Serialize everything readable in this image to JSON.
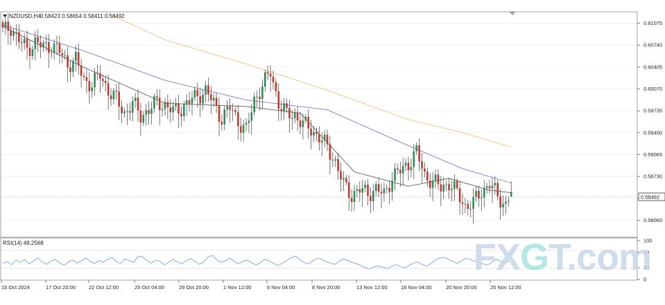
{
  "header": {
    "symbol": "NZDUSD,H4",
    "ohlc": "0.58423 0.58654 0.58411 0.58492"
  },
  "price_axis": {
    "ticks": [
      "0.61075",
      "0.60740",
      "0.60405",
      "0.60070",
      "0.59735",
      "0.59400",
      "0.59065",
      "0.58730",
      "0.58395",
      "0.58060"
    ],
    "current_price": "0.58492"
  },
  "rsi_panel": {
    "label": "RSI(14) 48.2568",
    "ticks": [
      "100",
      "70",
      "30",
      "0"
    ]
  },
  "time_axis": {
    "labels": [
      "15 Oct 2024",
      "17 Oct 20:00",
      "22 Oct 12:00",
      "25 Oct 04:00",
      "29 Oct 20:00",
      "1 Nov 12:00",
      "6 Nov 04:00",
      "8 Nov 20:00",
      "13 Nov 12:00",
      "18 Nov 04:00",
      "20 Nov 20:00",
      "25 Nov 12:00"
    ]
  },
  "watermark": {
    "text": "FXGT.com"
  },
  "colors": {
    "bull": "#2e8b57",
    "bear": "#c0392b",
    "ma_fast": "#606060",
    "ma_mid": "#7b7bd0",
    "ma_slow": "#f2c27a",
    "rsi": "#6fa8d6",
    "grid": "#e8e8e8",
    "watermark_main": "#c7d7e8",
    "watermark_accent": "#a7e3dc"
  },
  "chart_data": [
    {
      "type": "candlestick",
      "instrument": "NZDUSD",
      "timeframe": "H4",
      "x_labels": [
        "15 Oct 2024",
        "17 Oct 20:00",
        "22 Oct 12:00",
        "25 Oct 04:00",
        "29 Oct 20:00",
        "1 Nov 12:00",
        "6 Nov 04:00",
        "8 Nov 20:00",
        "13 Nov 12:00",
        "18 Nov 04:00",
        "20 Nov 20:00",
        "25 Nov 12:00"
      ],
      "y_ticks": [
        0.61075,
        0.6074,
        0.60405,
        0.6007,
        0.59735,
        0.594,
        0.59065,
        0.5873,
        0.58395,
        0.5806
      ],
      "ylim": [
        0.5781,
        0.6124
      ],
      "last_price": 0.58492,
      "last_bar": {
        "open": 0.58423,
        "high": 0.58654,
        "low": 0.58411,
        "close": 0.58492
      },
      "close_path": [
        [
          0,
          0.6095
        ],
        [
          3,
          0.6102
        ],
        [
          6,
          0.6081
        ],
        [
          9,
          0.6068
        ],
        [
          12,
          0.6078
        ],
        [
          15,
          0.6071
        ],
        [
          18,
          0.6074
        ],
        [
          21,
          0.6064
        ],
        [
          24,
          0.6045
        ],
        [
          27,
          0.6051
        ],
        [
          30,
          0.6021
        ],
        [
          33,
          0.6014
        ],
        [
          36,
          0.6028
        ],
        [
          39,
          0.6005
        ],
        [
          42,
          0.599
        ],
        [
          45,
          0.597
        ],
        [
          48,
          0.5985
        ],
        [
          51,
          0.5966
        ],
        [
          54,
          0.5975
        ],
        [
          57,
          0.5986
        ],
        [
          60,
          0.5983
        ],
        [
          63,
          0.5972
        ],
        [
          66,
          0.5978
        ],
        [
          69,
          0.5988
        ],
        [
          72,
          0.5997
        ],
        [
          75,
          0.6004
        ],
        [
          78,
          0.5985
        ],
        [
          81,
          0.5962
        ],
        [
          84,
          0.5978
        ],
        [
          87,
          0.5958
        ],
        [
          90,
          0.5943
        ],
        [
          93,
          0.599
        ],
        [
          96,
          0.6012
        ],
        [
          99,
          0.6032
        ],
        [
          102,
          0.5986
        ],
        [
          105,
          0.5967
        ],
        [
          108,
          0.5968
        ],
        [
          111,
          0.5952
        ],
        [
          114,
          0.5946
        ],
        [
          117,
          0.5932
        ],
        [
          120,
          0.5918
        ],
        [
          123,
          0.5895
        ],
        [
          126,
          0.586
        ],
        [
          129,
          0.5845
        ],
        [
          132,
          0.5852
        ],
        [
          135,
          0.5848
        ],
        [
          138,
          0.5853
        ],
        [
          141,
          0.5845
        ],
        [
          144,
          0.5873
        ],
        [
          147,
          0.5881
        ],
        [
          150,
          0.5893
        ],
        [
          153,
          0.591
        ],
        [
          156,
          0.5875
        ],
        [
          159,
          0.5865
        ],
        [
          162,
          0.5856
        ],
        [
          165,
          0.5863
        ],
        [
          168,
          0.5847
        ],
        [
          171,
          0.5828
        ],
        [
          174,
          0.5832
        ],
        [
          177,
          0.585
        ],
        [
          180,
          0.5862
        ],
        [
          183,
          0.5842
        ],
        [
          186,
          0.583
        ],
        [
          188,
          0.5849
        ]
      ],
      "moving_averages": [
        {
          "role": "fast",
          "path": [
            [
              0,
              0.6103
            ],
            [
              30,
              0.604
            ],
            [
              60,
              0.5985
            ],
            [
              90,
              0.598
            ],
            [
              110,
              0.597
            ],
            [
              130,
              0.588
            ],
            [
              150,
              0.5858
            ],
            [
              165,
              0.587
            ],
            [
              180,
              0.5852
            ],
            [
              188,
              0.5848
            ]
          ]
        },
        {
          "role": "mid",
          "path": [
            [
              0,
              0.6105
            ],
            [
              30,
              0.6065
            ],
            [
              60,
              0.602
            ],
            [
              90,
              0.599
            ],
            [
              120,
              0.5975
            ],
            [
              150,
              0.592
            ],
            [
              170,
              0.5885
            ],
            [
              188,
              0.5863
            ]
          ]
        },
        {
          "role": "slow",
          "path": [
            [
              38,
              0.6124
            ],
            [
              60,
              0.6082
            ],
            [
              90,
              0.6045
            ],
            [
              120,
              0.6005
            ],
            [
              150,
              0.596
            ],
            [
              170,
              0.594
            ],
            [
              188,
              0.5918
            ]
          ]
        }
      ]
    },
    {
      "type": "line",
      "series": [
        {
          "name": "RSI(14)",
          "last_value": 48.2568
        }
      ],
      "ylim": [
        0,
        100
      ],
      "y_ticks": [
        100,
        70,
        30,
        0
      ],
      "values": [
        42,
        46,
        38,
        50,
        44,
        52,
        40,
        47,
        55,
        45,
        39,
        48,
        51,
        43,
        36,
        45,
        50,
        42,
        48,
        55,
        47,
        41,
        49,
        44,
        52,
        57,
        46,
        41,
        53,
        48,
        44,
        60,
        58,
        49,
        42,
        50,
        46,
        38,
        44,
        52,
        45,
        40,
        48,
        54,
        47,
        39,
        45,
        58,
        62,
        50,
        44,
        48,
        55,
        46,
        40,
        47,
        50,
        43,
        37,
        44,
        52,
        48,
        41,
        36,
        42,
        49,
        56,
        60,
        51,
        44,
        40,
        48,
        55,
        52,
        46,
        42,
        39,
        47,
        53,
        49,
        44,
        40,
        36,
        30,
        27,
        32,
        35,
        31,
        28,
        34,
        38,
        33,
        30,
        36,
        42,
        45,
        38,
        34,
        41,
        50,
        55,
        57,
        52,
        46,
        42,
        48,
        55,
        51,
        47,
        43,
        40,
        37,
        45,
        52,
        46,
        42,
        48
      ]
    }
  ]
}
